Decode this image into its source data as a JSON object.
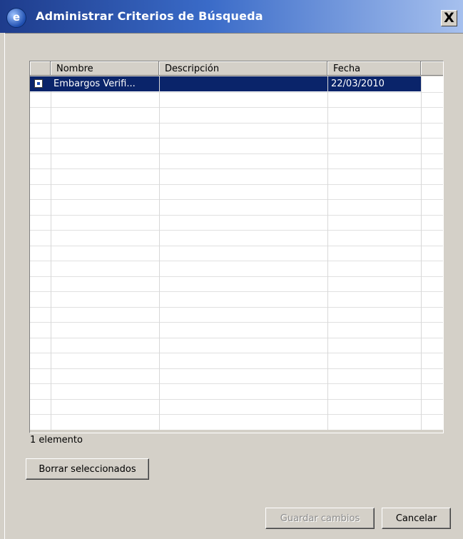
{
  "window": {
    "title": "Administrar Criterios de Búsqueda",
    "close_glyph": "X",
    "app_icon_glyph": "e"
  },
  "table": {
    "columns": [
      "Nombre",
      "Descripción",
      "Fecha"
    ],
    "rows": [
      {
        "selected": true,
        "nombre": "Embargos Verifi...",
        "descripcion": "",
        "fecha": "22/03/2010"
      }
    ],
    "status": "1 elemento"
  },
  "buttons": {
    "delete_selected": "Borrar seleccionados",
    "save_changes": "Guardar cambios",
    "cancel": "Cancelar"
  },
  "colors": {
    "selection": "#0a246a",
    "face": "#d4d0c8",
    "title_gradient_start": "#1e3c8c"
  }
}
